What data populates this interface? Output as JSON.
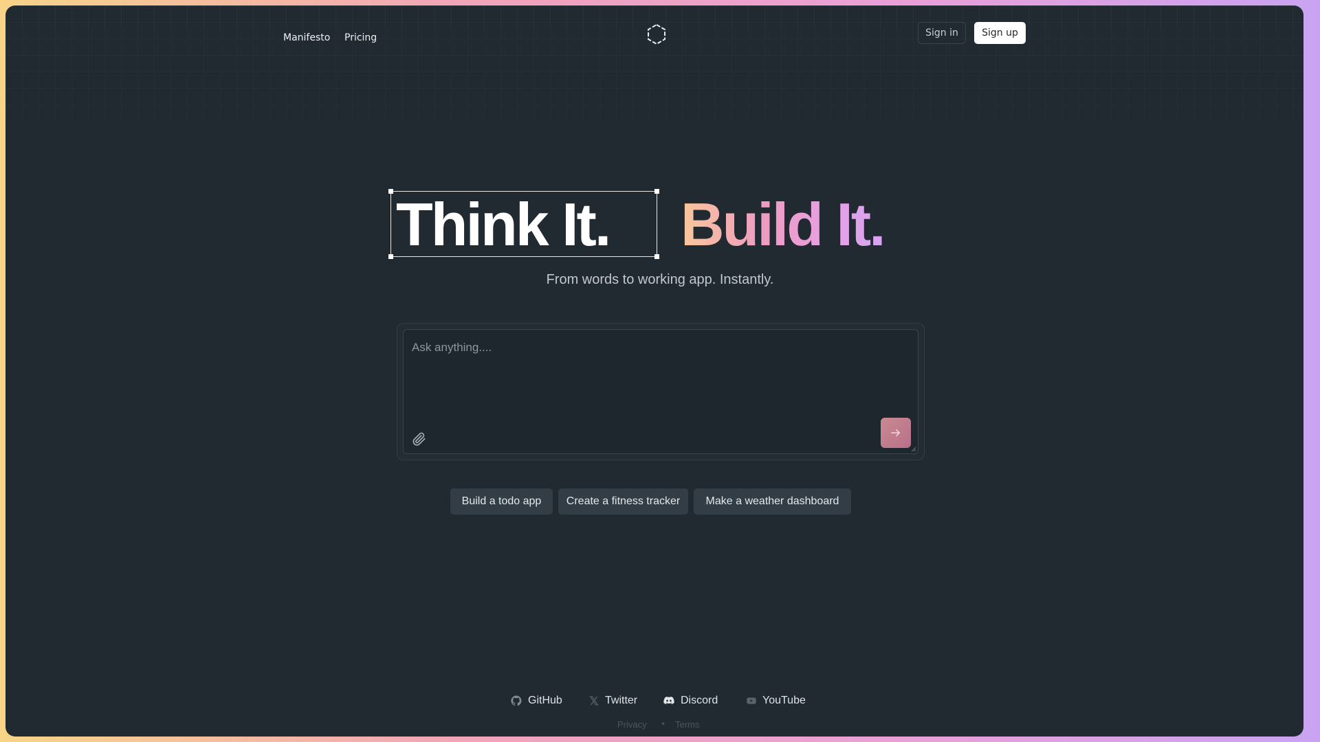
{
  "nav": {
    "links": [
      {
        "label": "Manifesto"
      },
      {
        "label": "Pricing"
      }
    ],
    "sign_in": "Sign in",
    "sign_up": "Sign up",
    "logo_icon": "hexagon-logo-icon"
  },
  "hero": {
    "title_part1": "Think It.",
    "title_part2": "Build It.",
    "subtitle": "From words to working app. Instantly."
  },
  "prompt": {
    "placeholder": "Ask anything....",
    "value": "",
    "attach_icon": "paperclip-icon",
    "send_icon": "arrow-right-icon"
  },
  "suggestions": [
    {
      "label": "Build a todo app"
    },
    {
      "label": "Create a fitness tracker"
    },
    {
      "label": "Make a weather dashboard"
    }
  ],
  "footer": {
    "social": [
      {
        "label": "GitHub",
        "icon": "github-icon"
      },
      {
        "label": "Twitter",
        "icon": "x-icon"
      },
      {
        "label": "Discord",
        "icon": "discord-icon"
      },
      {
        "label": "YouTube",
        "icon": "youtube-icon"
      }
    ],
    "privacy": "Privacy",
    "separator": "•",
    "terms": "Terms"
  },
  "colors": {
    "background": "#212a31",
    "gradient_start": "#f8c79a",
    "gradient_mid": "#ef9cc0",
    "gradient_end": "#d6a4f0",
    "send_button": "#c98a92"
  }
}
